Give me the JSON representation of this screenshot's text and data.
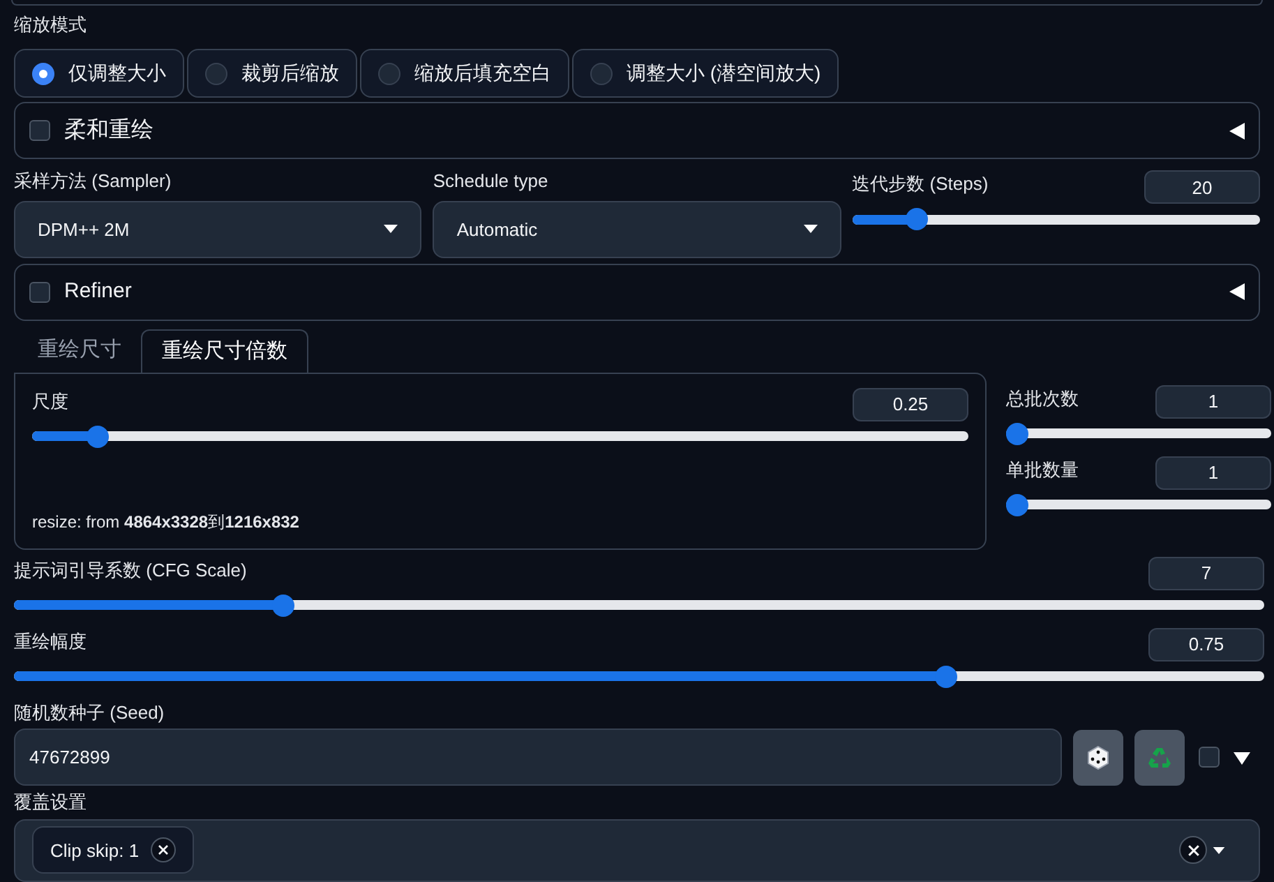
{
  "resize_mode": {
    "label": "缩放模式",
    "options": [
      {
        "label": "仅调整大小",
        "selected": true
      },
      {
        "label": "裁剪后缩放",
        "selected": false
      },
      {
        "label": "缩放后填充空白",
        "selected": false
      },
      {
        "label": "调整大小 (潜空间放大)",
        "selected": false
      }
    ]
  },
  "soft_inpainting": {
    "label": "柔和重绘",
    "checked": false,
    "expanded": false
  },
  "sampler": {
    "label": "采样方法 (Sampler)",
    "value": "DPM++ 2M"
  },
  "schedule_type": {
    "label": "Schedule type",
    "value": "Automatic"
  },
  "steps": {
    "label": "迭代步数 (Steps)",
    "value": "20",
    "level": 0.14
  },
  "refiner": {
    "label": "Refiner",
    "checked": false,
    "expanded": false
  },
  "resize_tabs": [
    {
      "label": "重绘尺寸",
      "selected": false
    },
    {
      "label": "重绘尺寸倍数",
      "selected": true
    }
  ],
  "scale": {
    "label": "尺度",
    "value": "0.25",
    "level": 0.06
  },
  "resize_info": "resize: from **4864x3328**到**1216x832**",
  "batch_count": {
    "label": "总批次数",
    "value": "1",
    "level": 0
  },
  "batch_size": {
    "label": "单批数量",
    "value": "1",
    "level": 0
  },
  "cfg_scale": {
    "label": "提示词引导系数 (CFG Scale)",
    "value": "7",
    "level": 0.21
  },
  "denoising": {
    "label": "重绘幅度",
    "value": "0.75",
    "level": 0.75
  },
  "seed": {
    "label": "随机数种子 (Seed)",
    "value": "47672899",
    "extra_checked": false,
    "expanded": false
  },
  "override_settings": {
    "label": "覆盖设置",
    "tags": [
      "Clip skip: 1"
    ]
  }
}
